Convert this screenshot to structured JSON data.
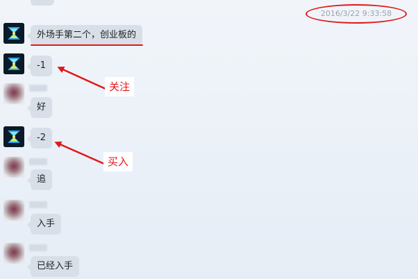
{
  "chat": {
    "timestamp": "2016/3/22 9:33:58",
    "messages": [
      {
        "sender": "dark",
        "text": "外场手第二个，创业板的"
      },
      {
        "sender": "dark",
        "text": "-1"
      },
      {
        "sender": "blur",
        "text": "好"
      },
      {
        "sender": "dark",
        "text": "-2"
      },
      {
        "sender": "blur",
        "text": "追"
      },
      {
        "sender": "blur",
        "text": "入手"
      },
      {
        "sender": "blur",
        "text": "已经入手"
      }
    ]
  },
  "annotations": {
    "label_1": "关注",
    "label_2": "买入",
    "color": "#e01818"
  }
}
